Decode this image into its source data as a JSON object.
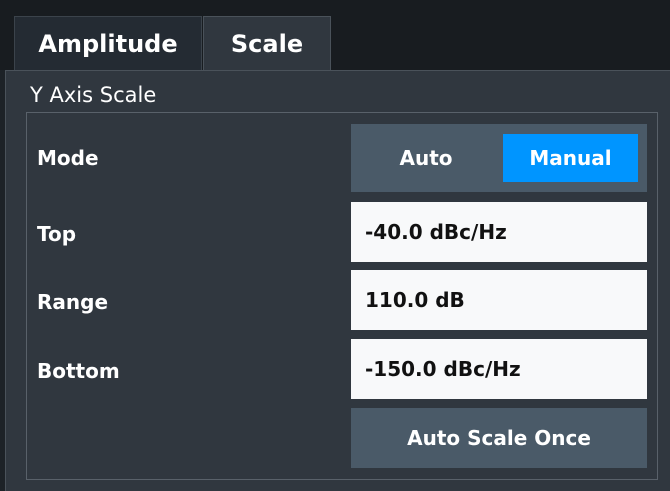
{
  "tabs": [
    {
      "label": "Amplitude",
      "selected": false
    },
    {
      "label": "Scale",
      "selected": true
    }
  ],
  "group": {
    "title": "Y Axis Scale"
  },
  "mode": {
    "label": "Mode",
    "options": [
      "Auto",
      "Manual"
    ],
    "selected": "Manual"
  },
  "top": {
    "label": "Top",
    "value": "-40.0 dBc/Hz"
  },
  "range": {
    "label": "Range",
    "value": "110.0 dB"
  },
  "bottom": {
    "label": "Bottom",
    "value": "-150.0 dBc/Hz"
  },
  "auto_scale": {
    "label": "Auto Scale Once"
  },
  "colors": {
    "accent": "#0095ff",
    "panel": "#30373f",
    "button": "#4a5a68"
  }
}
